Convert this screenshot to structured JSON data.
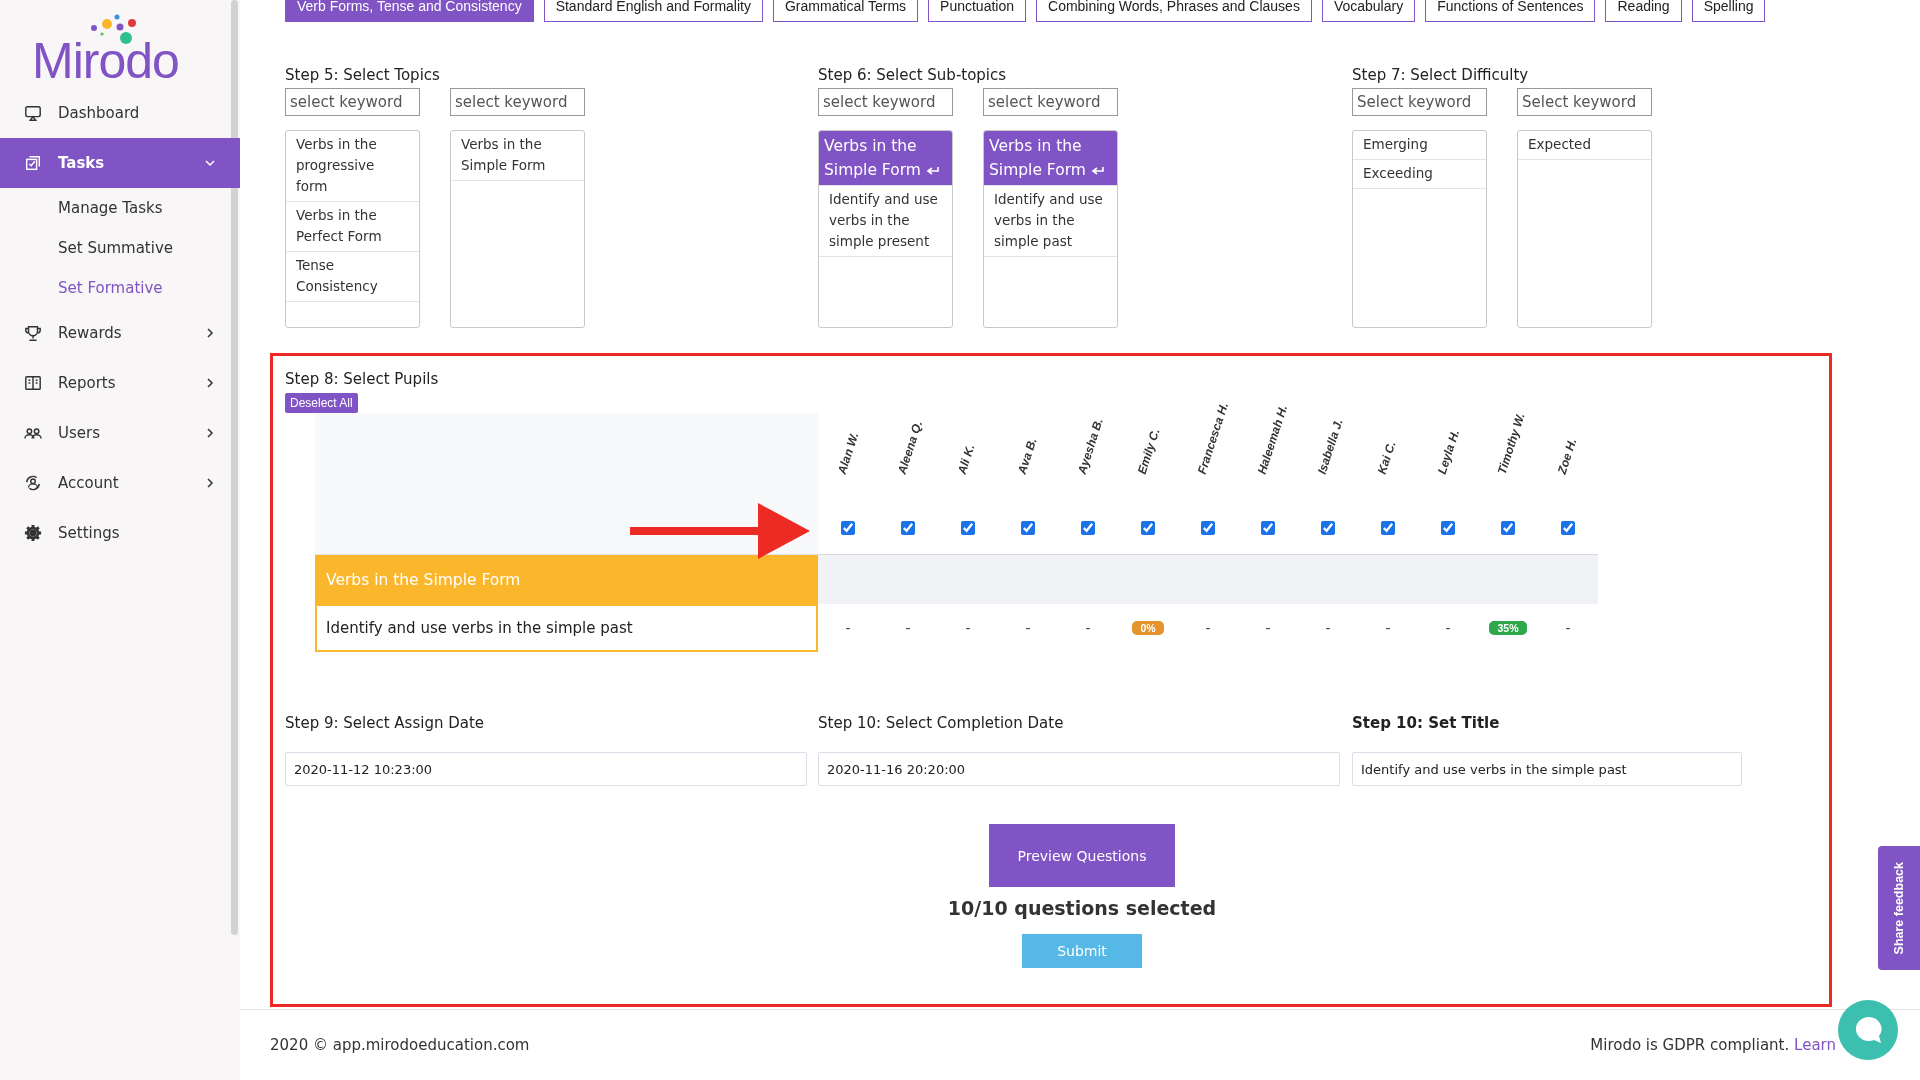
{
  "sidebar": {
    "logo": "Mirodo",
    "items": [
      {
        "label": "Dashboard",
        "kind": "link",
        "selected": false
      },
      {
        "label": "Tasks",
        "kind": "group",
        "selected": true,
        "expanded": true,
        "children": [
          {
            "label": "Manage Tasks",
            "selected": false
          },
          {
            "label": "Set Summative",
            "selected": false
          },
          {
            "label": "Set Formative",
            "selected": true
          }
        ]
      },
      {
        "label": "Rewards",
        "kind": "group",
        "selected": false,
        "expanded": false
      },
      {
        "label": "Reports",
        "kind": "group",
        "selected": false,
        "expanded": false
      },
      {
        "label": "Users",
        "kind": "group",
        "selected": false,
        "expanded": false
      },
      {
        "label": "Account",
        "kind": "group",
        "selected": false,
        "expanded": false
      },
      {
        "label": "Settings",
        "kind": "link",
        "selected": false
      }
    ]
  },
  "tabs": [
    {
      "label": "Verb Forms, Tense and Consistency",
      "selected": true
    },
    {
      "label": "Standard English and Formality",
      "selected": false
    },
    {
      "label": "Grammatical Terms",
      "selected": false
    },
    {
      "label": "Punctuation",
      "selected": false
    },
    {
      "label": "Combining Words, Phrases and Clauses",
      "selected": false
    },
    {
      "label": "Vocabulary",
      "selected": false
    },
    {
      "label": "Functions of Sentences",
      "selected": false
    },
    {
      "label": "Reading",
      "selected": false
    },
    {
      "label": "Spelling",
      "selected": false
    }
  ],
  "steps": [
    {
      "title": "Step 5: Select Topics",
      "panels": [
        {
          "placeholder": "select keyword",
          "items": [
            {
              "label": "Verbs in the progressive form",
              "selected": false
            },
            {
              "label": "Verbs in the Perfect Form",
              "selected": false
            },
            {
              "label": "Tense Consistency",
              "selected": false
            }
          ]
        },
        {
          "placeholder": "select keyword",
          "items": [
            {
              "label": "Verbs in the Simple Form",
              "selected": false
            }
          ]
        }
      ]
    },
    {
      "title": "Step 6: Select Sub-topics",
      "panels": [
        {
          "placeholder": "select keyword",
          "items": [
            {
              "label": "Verbs in the Simple Form",
              "selected": true
            },
            {
              "label": "Identify and use verbs in the simple present",
              "selected": false
            }
          ]
        },
        {
          "placeholder": "select keyword",
          "items": [
            {
              "label": "Verbs in the Simple Form",
              "selected": true
            },
            {
              "label": "Identify and use verbs in the simple past",
              "selected": false
            }
          ]
        }
      ]
    },
    {
      "title": "Step 7: Select Difficulty",
      "panels": [
        {
          "placeholder": "Select keyword",
          "items": [
            {
              "label": "Emerging",
              "selected": false
            },
            {
              "label": "Exceeding",
              "selected": false
            }
          ]
        },
        {
          "placeholder": "Select keyword",
          "items": [
            {
              "label": "Expected",
              "selected": false
            }
          ]
        }
      ]
    }
  ],
  "pupils": {
    "title": "Step 8: Select Pupils",
    "deselect_button": "Deselect All",
    "students": [
      {
        "name": "Alan W.",
        "checked": true
      },
      {
        "name": "Aleena Q.",
        "checked": true
      },
      {
        "name": "Ali K.",
        "checked": true
      },
      {
        "name": "Ava B.",
        "checked": true
      },
      {
        "name": "Ayesha B.",
        "checked": true
      },
      {
        "name": "Emily C.",
        "checked": true
      },
      {
        "name": "Francesca H.",
        "checked": true
      },
      {
        "name": "Haleemah H.",
        "checked": true
      },
      {
        "name": "Isabella J.",
        "checked": true
      },
      {
        "name": "Kai C.",
        "checked": true
      },
      {
        "name": "Leyla H.",
        "checked": true
      },
      {
        "name": "Timothy W.",
        "checked": true
      },
      {
        "name": "Zoe H.",
        "checked": true
      }
    ],
    "topic": "Verbs in the Simple Form",
    "rows": [
      {
        "label": "Identify and use verbs in the simple past",
        "scores": [
          {
            "text": "-"
          },
          {
            "text": "-"
          },
          {
            "text": "-"
          },
          {
            "text": "-"
          },
          {
            "text": "-"
          },
          {
            "text": "0%",
            "color": "#e5932b"
          },
          {
            "text": "-"
          },
          {
            "text": "-"
          },
          {
            "text": "-"
          },
          {
            "text": "-"
          },
          {
            "text": "-"
          },
          {
            "text": "35%",
            "color": "#2ea84a"
          },
          {
            "text": "-"
          }
        ]
      }
    ]
  },
  "fields": [
    {
      "label": "Step 9: Select Assign Date",
      "value": "2020-11-12 10:23:00",
      "bold": false
    },
    {
      "label": "Step 10: Select Completion Date",
      "value": "2020-11-16 20:20:00",
      "bold": false
    },
    {
      "label": "Step 10: Set Title",
      "value": "Identify and use verbs in the simple past",
      "bold": true
    }
  ],
  "preview_button": "Preview Questions",
  "selected_count": "10/10 questions selected",
  "submit_button": "Submit",
  "footer": {
    "copyright": "2020 © app.mirodoeducation.com",
    "notice": "Mirodo is GDPR compliant.",
    "link": "Learn"
  },
  "feedback_tab": "Share feedback"
}
